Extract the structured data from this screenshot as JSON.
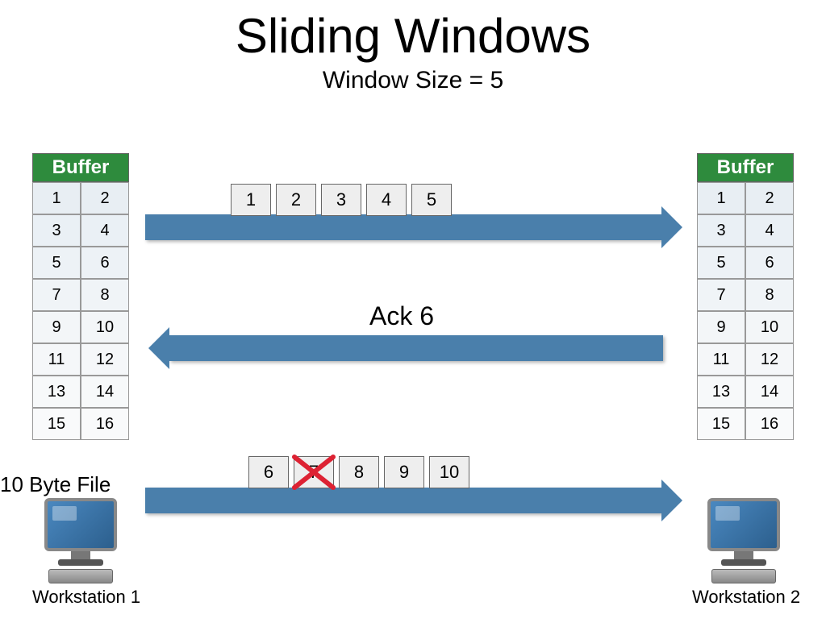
{
  "title": "Sliding Windows",
  "subtitle": "Window Size = 5",
  "buffer_header": "Buffer",
  "buffer_rows": [
    [
      "1",
      "2"
    ],
    [
      "3",
      "4"
    ],
    [
      "5",
      "6"
    ],
    [
      "7",
      "8"
    ],
    [
      "9",
      "10"
    ],
    [
      "11",
      "12"
    ],
    [
      "13",
      "14"
    ],
    [
      "15",
      "16"
    ]
  ],
  "packets_top": [
    "1",
    "2",
    "3",
    "4",
    "5"
  ],
  "ack_label": "Ack 6",
  "packets_bottom": [
    "6",
    "7",
    "8",
    "9",
    "10"
  ],
  "lost_packet_index": 1,
  "file_label": "10 Byte File",
  "ws1": "Workstation 1",
  "ws2": "Workstation 2",
  "chart_data": {
    "type": "table",
    "title": "Sliding Windows",
    "window_size": 5,
    "file_size_bytes": 10,
    "buffer_size_cells": 16,
    "sender": "Workstation 1",
    "receiver": "Workstation 2",
    "first_send_segments": [
      1,
      2,
      3,
      4,
      5
    ],
    "ack_received": 6,
    "second_send_segments": [
      6,
      7,
      8,
      9,
      10
    ],
    "lost_segment": 7
  }
}
